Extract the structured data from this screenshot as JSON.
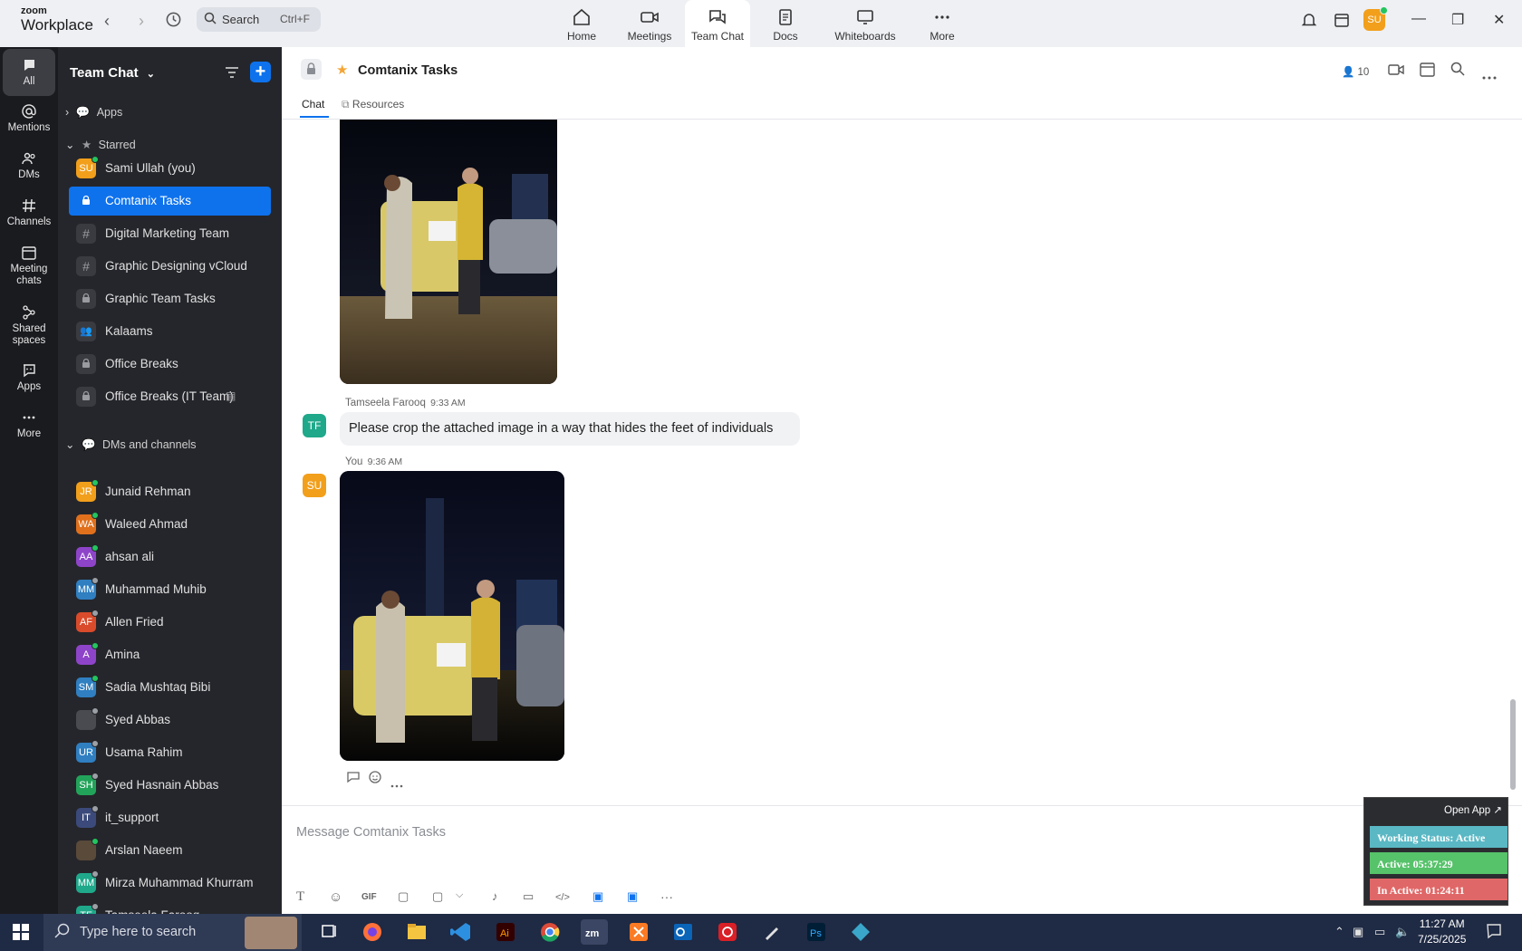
{
  "app": {
    "brand_small": "zoom",
    "brand_large": "Workplace"
  },
  "topbar": {
    "search_label": "Search",
    "search_shortcut": "Ctrl+F",
    "nav": [
      {
        "label": "Home",
        "icon": "home-icon"
      },
      {
        "label": "Meetings",
        "icon": "video-camera-icon"
      },
      {
        "label": "Team Chat",
        "icon": "chat-bubbles-icon",
        "active": true
      },
      {
        "label": "Docs",
        "icon": "document-icon"
      },
      {
        "label": "Whiteboards",
        "icon": "whiteboard-icon"
      },
      {
        "label": "More",
        "icon": "more-dots-icon"
      }
    ],
    "avatar_initials": "SU",
    "accent_color": "#0e72ed"
  },
  "rail": [
    {
      "label": "All",
      "icon": "chat-icon",
      "active": true
    },
    {
      "label": "Mentions",
      "icon": "at-icon"
    },
    {
      "label": "DMs",
      "icon": "people-icon"
    },
    {
      "label": "Channels",
      "icon": "hash-icon"
    },
    {
      "label": "Meeting chats",
      "icon": "calendar-icon"
    },
    {
      "label": "Shared spaces",
      "icon": "shared-icon"
    },
    {
      "label": "Apps",
      "icon": "apps-icon"
    },
    {
      "label": "More",
      "icon": "more-dots-icon"
    }
  ],
  "sidebar": {
    "title": "Team Chat",
    "apps_label": "Apps",
    "starred_label": "Starred",
    "dms_label": "DMs and channels",
    "starred": [
      {
        "label": "Sami Ullah (you)",
        "kind": "avatar",
        "initials": "SU",
        "color": "#f29f1b",
        "status": "#22c55e"
      },
      {
        "label": "Comtanix Tasks",
        "kind": "lock",
        "selected": true
      },
      {
        "label": "Digital Marketing Team",
        "kind": "hash"
      },
      {
        "label": "Graphic Designing vCloud",
        "kind": "hash"
      },
      {
        "label": "Graphic Team Tasks",
        "kind": "lock"
      },
      {
        "label": "Kalaams",
        "kind": "group"
      },
      {
        "label": "Office Breaks",
        "kind": "lock"
      },
      {
        "label": "Office Breaks (IT Team)",
        "kind": "lock"
      }
    ],
    "dms": [
      {
        "label": "Junaid Rehman",
        "initials": "JR",
        "color": "#f29f1b",
        "status": "#22c55e"
      },
      {
        "label": "Waleed Ahmad",
        "initials": "WA",
        "color": "#e0701c",
        "status": "#22c55e"
      },
      {
        "label": "ahsan ali",
        "initials": "AA",
        "color": "#8e44c9",
        "status": "#22c55e"
      },
      {
        "label": "Muhammad Muhib",
        "initials": "MM",
        "color": "#2f7fc1",
        "status": "#9aa0a6"
      },
      {
        "label": "Allen Fried",
        "initials": "AF",
        "color": "#d94b2b",
        "status": "#9aa0a6"
      },
      {
        "label": "Amina",
        "initials": "A",
        "color": "#8e44c9",
        "status": "#22c55e"
      },
      {
        "label": "Sadia Mushtaq Bibi",
        "initials": "SM",
        "color": "#2f7fc1",
        "status": "#22c55e"
      },
      {
        "label": "Syed Abbas",
        "initials": "",
        "color": "#4a4b50",
        "status": "#9aa0a6"
      },
      {
        "label": "Usama Rahim",
        "initials": "UR",
        "color": "#2f7fc1",
        "status": "#9aa0a6"
      },
      {
        "label": "Syed Hasnain Abbas",
        "initials": "SH",
        "color": "#22a35a",
        "status": "#9aa0a6"
      },
      {
        "label": "it_support",
        "initials": "IT",
        "color": "#3b4a7a",
        "status": "#9aa0a6"
      },
      {
        "label": "Arslan Naeem",
        "initials": "",
        "color": "#5a4a3a",
        "status": "#22c55e"
      },
      {
        "label": "Mirza Muhammad Khurram",
        "initials": "MM",
        "color": "#1fa88a",
        "status": "#9aa0a6"
      },
      {
        "label": "Tamseela Farooq",
        "initials": "TF",
        "color": "#1fa88a",
        "status": "#9aa0a6"
      }
    ]
  },
  "chat": {
    "title": "Comtanix Tasks",
    "member_count": "10",
    "tabs": [
      "Chat",
      "Resources"
    ],
    "messages": [
      {
        "sender": "Tamseela Farooq",
        "time": "9:33 AM",
        "initials": "TF",
        "color": "#1fa88a",
        "text": "Please crop the attached image in a way that hides the feet of individuals"
      },
      {
        "sender": "You",
        "time": "9:36 AM",
        "initials": "SU",
        "color": "#f29f1b"
      }
    ],
    "composer_placeholder": "Message Comtanix Tasks",
    "composer_tools": [
      "T",
      "☺",
      "GIF",
      "▢",
      "▢",
      "⌵",
      "♪",
      "▭",
      "</>",
      "▣",
      "▣",
      "···"
    ]
  },
  "status_widget": {
    "open_app": "Open App ↗",
    "rows": [
      {
        "label": "Working Status: Active",
        "color": "#5ab8c4"
      },
      {
        "label": "Active: 05:37:29",
        "color": "#56c26a"
      },
      {
        "label": "In Active: 01:24:11",
        "color": "#e06767"
      }
    ]
  },
  "taskbar": {
    "search_placeholder": "Type here to search",
    "time": "11:27 AM",
    "date": "7/25/2025"
  }
}
